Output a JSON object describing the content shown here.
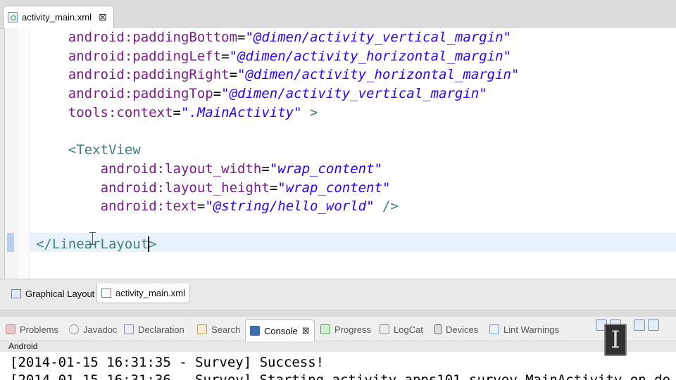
{
  "editor": {
    "tab_title": "activity_main.xml",
    "tab_close": "⊠",
    "lines": [
      {
        "indent": "    ",
        "attr": "android:paddingBottom",
        "eq": "=",
        "val": "\"@dimen/activity_vertical_margin\"",
        "tail": ""
      },
      {
        "indent": "    ",
        "attr": "android:paddingLeft",
        "eq": "=",
        "val": "\"@dimen/activity_horizontal_margin\"",
        "tail": ""
      },
      {
        "indent": "    ",
        "attr": "android:paddingRight",
        "eq": "=",
        "val": "\"@dimen/activity_horizontal_margin\"",
        "tail": ""
      },
      {
        "indent": "    ",
        "attr": "android:paddingTop",
        "eq": "=",
        "val": "\"@dimen/activity_vertical_margin\"",
        "tail": ""
      },
      {
        "indent": "    ",
        "attr": "tools:context",
        "eq": "=",
        "val": "\".MainActivity\"",
        "tail": " >"
      },
      {
        "indent": "",
        "attr": "",
        "eq": "",
        "val": "",
        "tail": ""
      },
      {
        "indent": "    ",
        "tag": "<TextView"
      },
      {
        "indent": "        ",
        "attr": "android:layout_width",
        "eq": "=",
        "val": "\"wrap_content\"",
        "tail": ""
      },
      {
        "indent": "        ",
        "attr": "android:layout_height",
        "eq": "=",
        "val": "\"wrap_content\"",
        "tail": ""
      },
      {
        "indent": "        ",
        "attr": "android:text",
        "eq": "=",
        "val": "\"@string/hello_world\"",
        "tail": " />"
      },
      {
        "indent": "",
        "attr": "",
        "eq": "",
        "val": "",
        "tail": ""
      },
      {
        "indent": "",
        "tag_before_caret": "</LinearLayout",
        "tag_after_caret": ">"
      }
    ]
  },
  "editor_bottom_tabs": [
    {
      "label": "Graphical Layout",
      "icon": "layout-icon"
    },
    {
      "label": "activity_main.xml",
      "icon": "xml-file-icon"
    }
  ],
  "views": {
    "tabs": [
      {
        "label": "Problems",
        "icon": "problems-icon"
      },
      {
        "label": "Javadoc",
        "icon": "javadoc-icon"
      },
      {
        "label": "Declaration",
        "icon": "declaration-icon"
      },
      {
        "label": "Search",
        "icon": "search-icon"
      },
      {
        "label": "Console",
        "icon": "console-icon",
        "close": "⊠"
      },
      {
        "label": "Progress",
        "icon": "progress-icon"
      },
      {
        "label": "LogCat",
        "icon": "logcat-icon"
      },
      {
        "label": "Devices",
        "icon": "devices-icon"
      },
      {
        "label": "Lint Warnings",
        "icon": "lint-icon"
      }
    ],
    "active": "Console"
  },
  "console": {
    "label": "Android",
    "lines": [
      "[2014-01-15 16:31:35 - Survey] Success!",
      "[2014-01-15 16:31:36 - Survey] Starting activity apps101.survey.MainActivity on de"
    ]
  },
  "watermark": {
    "glyph": "I"
  }
}
